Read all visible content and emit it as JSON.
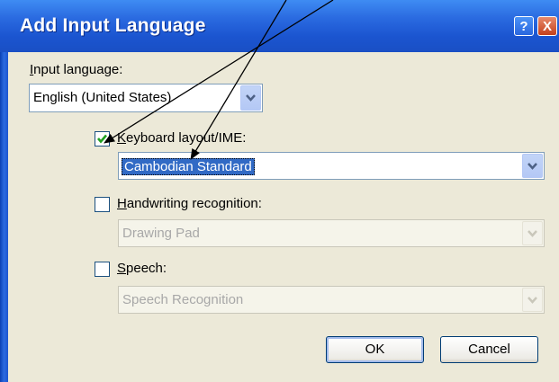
{
  "window": {
    "title": "Add Input Language",
    "help_symbol": "?",
    "close_symbol": "X"
  },
  "input_language": {
    "label_prefix": "I",
    "label_rest": "nput language:",
    "value": "English (United States)"
  },
  "keyboard": {
    "checked": true,
    "label_prefix": "K",
    "label_rest": "eyboard layout/IME:",
    "value": "Cambodian Standard"
  },
  "handwriting": {
    "checked": false,
    "label_prefix": "H",
    "label_rest": "andwriting recognition:",
    "value": "Drawing Pad"
  },
  "speech": {
    "checked": false,
    "label_prefix": "S",
    "label_rest": "peech:",
    "value": "Speech Recognition"
  },
  "buttons": {
    "ok": "OK",
    "cancel": "Cancel"
  },
  "colors": {
    "title_bar": "#2a6ae0",
    "dialog_bg": "#ece9d8",
    "selection": "#316ac5",
    "check_green": "#21a121"
  },
  "annotations": {
    "arrows": [
      "arrow-to-keyboard-checkbox",
      "arrow-to-keyboard-combo"
    ]
  }
}
